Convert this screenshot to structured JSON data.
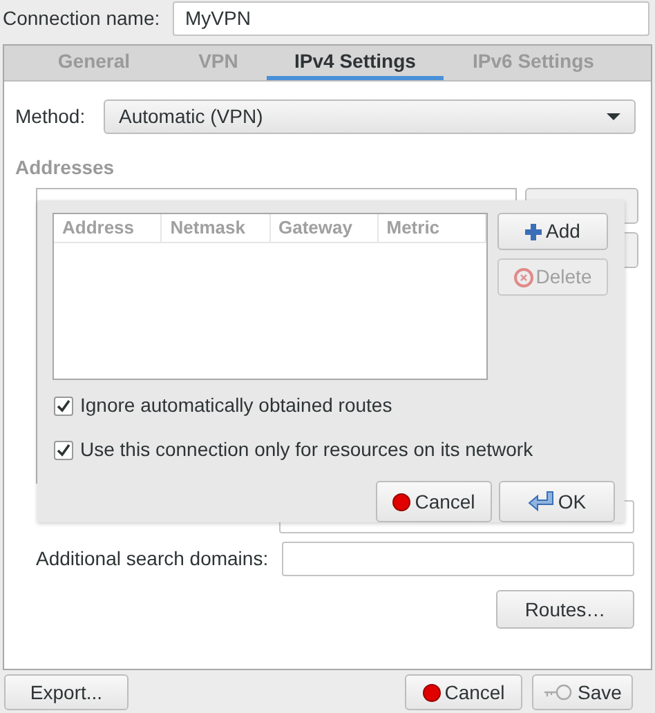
{
  "connection_name": {
    "label": "Connection name:",
    "value": "MyVPN"
  },
  "tabs": [
    {
      "label": "General",
      "selected": false
    },
    {
      "label": "VPN",
      "selected": false
    },
    {
      "label": "IPv4 Settings",
      "selected": true
    },
    {
      "label": "IPv6 Settings",
      "selected": false
    }
  ],
  "method": {
    "label": "Method:",
    "value": "Automatic (VPN)"
  },
  "addresses": {
    "heading": "Addresses"
  },
  "search_domains": {
    "label": "Additional search domains:"
  },
  "routes_button": "Routes…",
  "footer": {
    "export": "Export...",
    "cancel": "Cancel",
    "save": "Save"
  },
  "routes_dialog": {
    "columns": [
      "Address",
      "Netmask",
      "Gateway",
      "Metric"
    ],
    "add": "Add",
    "delete": {
      "label": "Delete",
      "disabled": true
    },
    "options": [
      {
        "label": "Ignore automatically obtained routes",
        "checked": true
      },
      {
        "label": "Use this connection only for resources on its network",
        "checked": true
      }
    ],
    "cancel": "Cancel",
    "ok": "OK"
  }
}
